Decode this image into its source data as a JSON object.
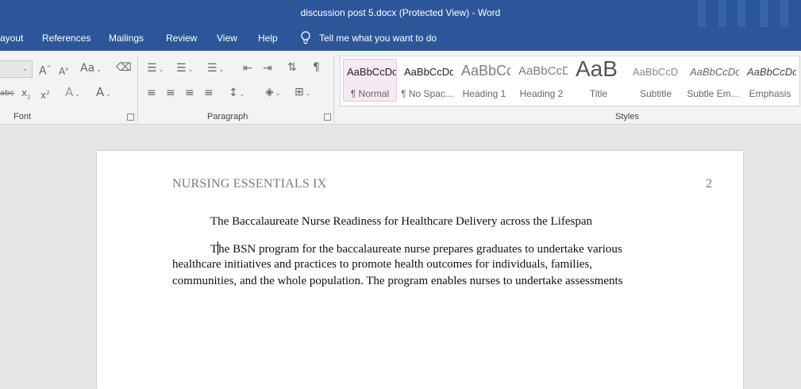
{
  "window": {
    "title": "discussion post 5.docx (Protected View)  -  Word"
  },
  "tabs": [
    {
      "label": "ayout"
    },
    {
      "label": "References"
    },
    {
      "label": "Mailings"
    },
    {
      "label": "Review"
    },
    {
      "label": "View"
    },
    {
      "label": "Help"
    }
  ],
  "tell_me": "Tell me what you want to do",
  "ribbon": {
    "font_group": "Font",
    "paragraph_group": "Paragraph",
    "styles_group": "Styles",
    "font_tools": {
      "grow": "A",
      "shrink": "A",
      "case": "Aa",
      "strike": "abc",
      "subscript": "x",
      "superscript": "x",
      "effects": "A",
      "color": "A"
    },
    "styles": [
      {
        "preview": "AaBbCcDd",
        "name": "¶ Normal",
        "color": "#222222"
      },
      {
        "preview": "AaBbCcDd",
        "name": "¶ No Spac...",
        "color": "#222222"
      },
      {
        "preview": "AaBbCc",
        "name": "Heading 1",
        "color": "#7f7f7f"
      },
      {
        "preview": "AaBbCcD",
        "name": "Heading 2",
        "color": "#7f7f7f"
      },
      {
        "preview": "AaB",
        "name": "Title",
        "color": "#555555"
      },
      {
        "preview": "AaBbCcD",
        "name": "Subtitle",
        "color": "#8a8a8a"
      },
      {
        "preview": "AaBbCcDd",
        "name": "Subtle Em...",
        "color": "#666666"
      },
      {
        "preview": "AaBbCcDd",
        "name": "Emphasis",
        "color": "#444444"
      }
    ]
  },
  "document": {
    "header": "NURSING ESSENTIALS IX",
    "page_number": "2",
    "title": "The Baccalaureate Nurse Readiness for Healthcare Delivery across the Lifespan",
    "line1_start": "T",
    "line1_rest": "he BSN program for the baccalaureate nurse prepares graduates to undertake various",
    "line2": "healthcare initiatives and practices to promote health outcomes for individuals, families,",
    "line3": "communities, and the whole population. The program enables nurses to undertake assessments"
  }
}
